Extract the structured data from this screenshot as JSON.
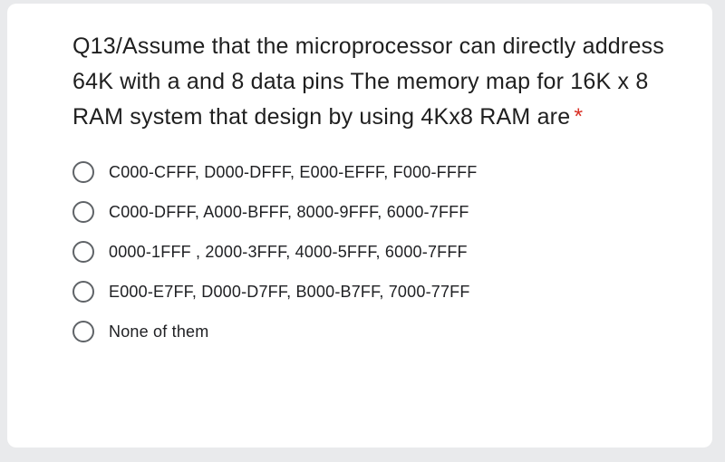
{
  "question": {
    "prefix": "Q13/",
    "text": "Assume that the microprocessor can directly address 64K with a and 8 data pins The memory map for 16K x 8 RAM system that design by using 4Kx8 RAM are",
    "required_marker": "*"
  },
  "options": [
    {
      "label": "C000-CFFF, D000-DFFF, E000-EFFF, F000-FFFF"
    },
    {
      "label": "C000-DFFF, A000-BFFF, 8000-9FFF, 6000-7FFF"
    },
    {
      "label": "0000-1FFF , 2000-3FFF, 4000-5FFF, 6000-7FFF"
    },
    {
      "label": "E000-E7FF, D000-D7FF, B000-B7FF, 7000-77FF"
    },
    {
      "label": "None of them"
    }
  ]
}
